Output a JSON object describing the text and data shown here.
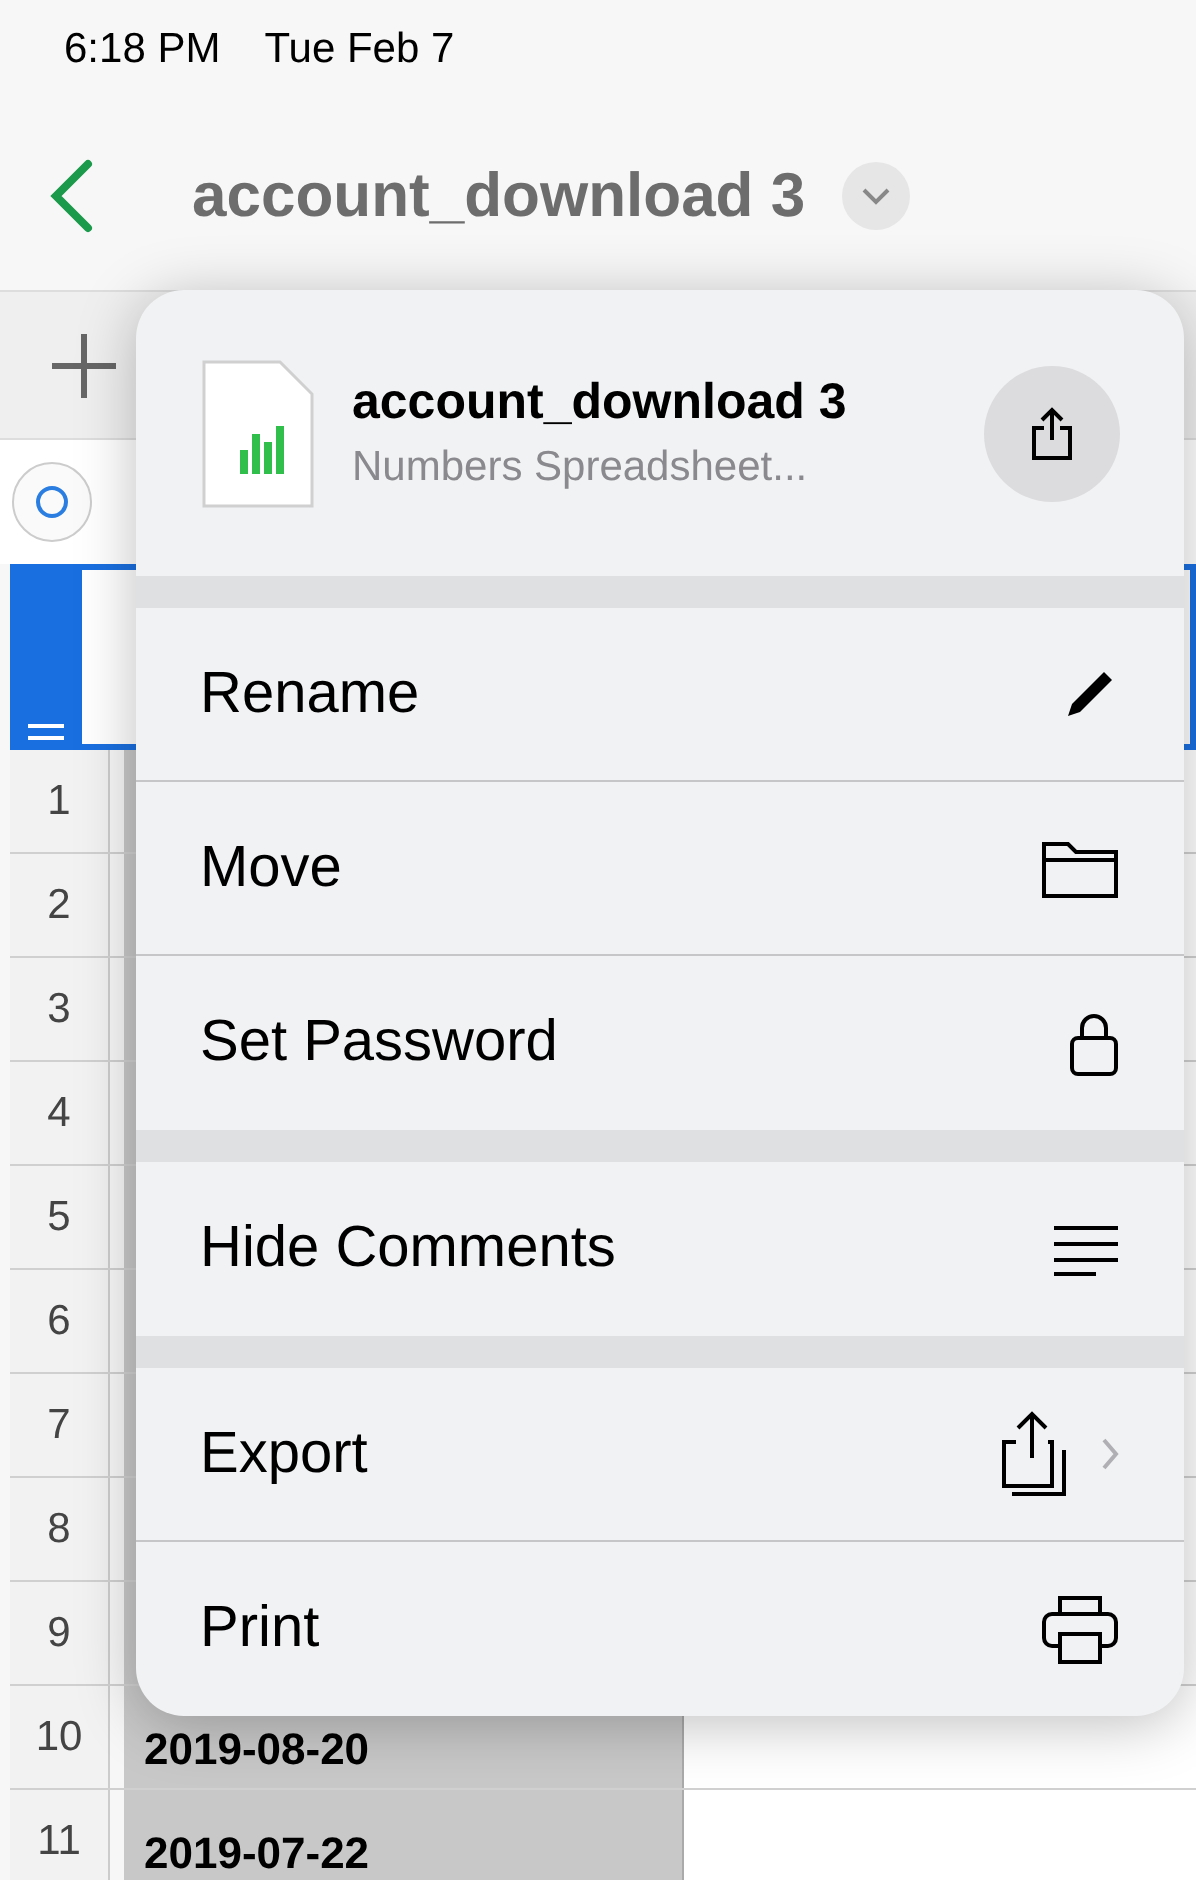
{
  "status_bar": {
    "time": "6:18 PM",
    "date": "Tue Feb 7"
  },
  "nav": {
    "title": "account_download 3"
  },
  "sheet": {
    "rows": [
      {
        "number": "1",
        "cell": ""
      },
      {
        "number": "2",
        "cell": ""
      },
      {
        "number": "3",
        "cell": ""
      },
      {
        "number": "4",
        "cell": ""
      },
      {
        "number": "5",
        "cell": ""
      },
      {
        "number": "6",
        "cell": ""
      },
      {
        "number": "7",
        "cell": ""
      },
      {
        "number": "8",
        "cell": ""
      },
      {
        "number": "9",
        "cell": ""
      },
      {
        "number": "10",
        "cell": "2019-08-20"
      },
      {
        "number": "11",
        "cell": "2019-07-22"
      }
    ]
  },
  "menu": {
    "file": {
      "name": "account_download 3",
      "type": "Numbers Spreadsheet..."
    },
    "groups": [
      [
        {
          "label": "Rename",
          "kind": "pencil",
          "submenu": false
        },
        {
          "label": "Move",
          "kind": "folder",
          "submenu": false
        },
        {
          "label": "Set Password",
          "kind": "lock",
          "submenu": false
        }
      ],
      [
        {
          "label": "Hide Comments",
          "kind": "lines",
          "submenu": false
        }
      ],
      [
        {
          "label": "Export",
          "kind": "export",
          "submenu": true
        },
        {
          "label": "Print",
          "kind": "printer",
          "submenu": false
        }
      ]
    ]
  }
}
